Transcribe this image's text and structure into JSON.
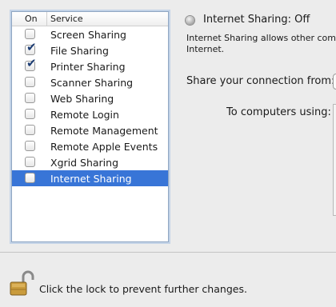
{
  "services_list": {
    "header_on": "On",
    "header_service": "Service",
    "items": [
      {
        "label": "Screen Sharing",
        "checked": false,
        "selected": false
      },
      {
        "label": "File Sharing",
        "checked": true,
        "selected": false
      },
      {
        "label": "Printer Sharing",
        "checked": true,
        "selected": false
      },
      {
        "label": "Scanner Sharing",
        "checked": false,
        "selected": false
      },
      {
        "label": "Web Sharing",
        "checked": false,
        "selected": false
      },
      {
        "label": "Remote Login",
        "checked": false,
        "selected": false
      },
      {
        "label": "Remote Management",
        "checked": false,
        "selected": false
      },
      {
        "label": "Remote Apple Events",
        "checked": false,
        "selected": false
      },
      {
        "label": "Xgrid Sharing",
        "checked": false,
        "selected": false
      },
      {
        "label": "Internet Sharing",
        "checked": false,
        "selected": true
      }
    ]
  },
  "detail": {
    "status": "Internet Sharing: Off",
    "status_light_icon": "gray-status-light-icon",
    "description_line1": "Internet Sharing allows other comp",
    "description_line2": "Internet.",
    "share_from_label": "Share your connection from:",
    "to_computers_label": "To computers using:"
  },
  "footer": {
    "lock_icon": "unlocked-padlock-icon",
    "lock_text": "Click the lock to prevent further changes."
  },
  "colors": {
    "selection": "#3875d7",
    "background": "#ececec",
    "list_border": "#8fa6c3"
  }
}
